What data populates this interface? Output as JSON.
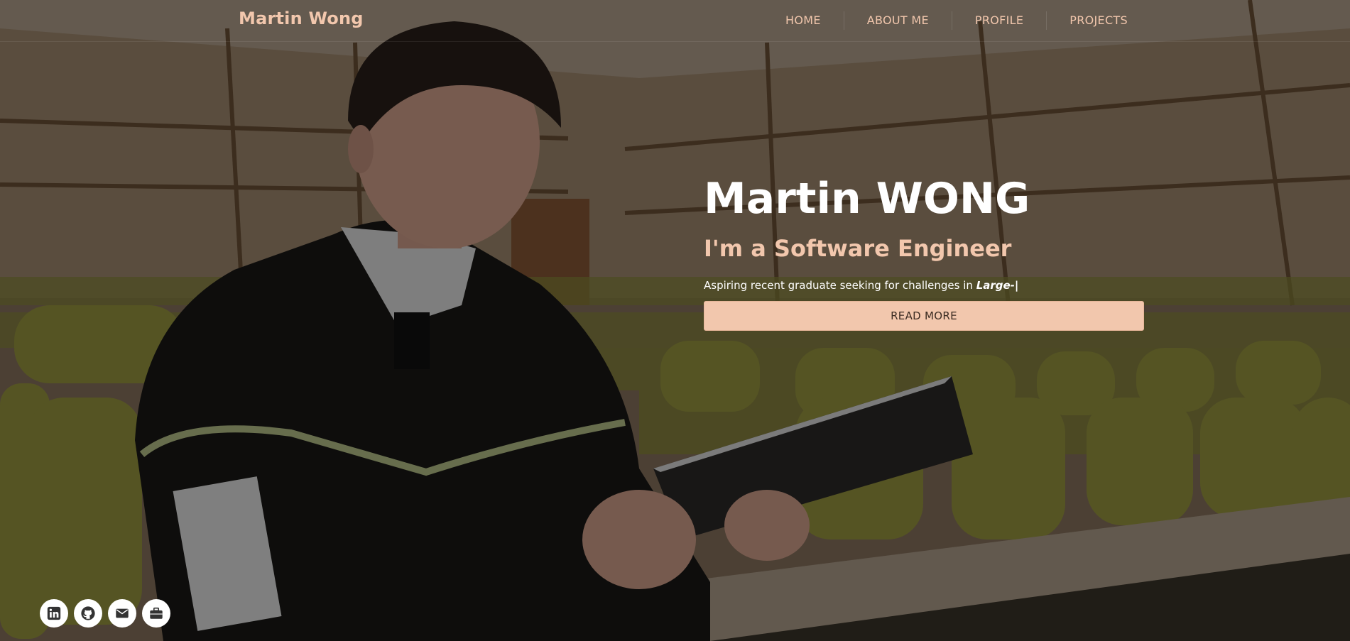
{
  "navbar": {
    "brand": "Martin Wong",
    "links": [
      {
        "label": "HOME"
      },
      {
        "label": "ABOUT ME"
      },
      {
        "label": "PROFILE"
      },
      {
        "label": "PROJECTS"
      }
    ]
  },
  "hero": {
    "name": "Martin WONG",
    "role": "I'm a Software Engineer",
    "description_prefix": "Aspiring recent graduate seeking for challenges in ",
    "description_typed": "Large-|",
    "button_label": "READ MORE"
  },
  "socials": [
    {
      "icon": "linkedin-icon"
    },
    {
      "icon": "github-icon"
    },
    {
      "icon": "mail-icon"
    },
    {
      "icon": "briefcase-icon"
    }
  ],
  "colors": {
    "accent": "#f2c7ad",
    "heading": "#ffffff",
    "overlay": "rgba(0,0,0,0.45)"
  }
}
